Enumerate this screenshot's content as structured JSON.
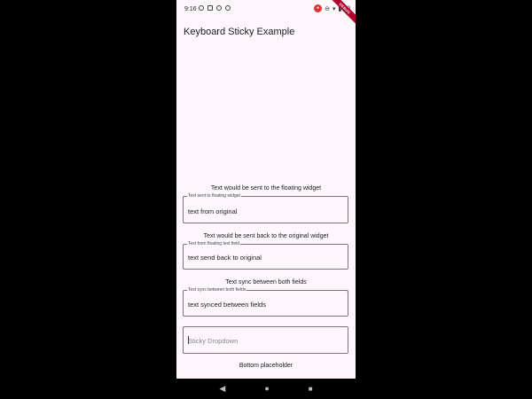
{
  "status_bar": {
    "time": "9:16",
    "notification_icons": [
      "settings-icon",
      "sim-icon",
      "settings-icon",
      "settings-icon"
    ],
    "battery_percent": "99",
    "recording_badge": "●"
  },
  "debug_banner": "DEBUG",
  "app": {
    "title": "Keyboard Sticky Example"
  },
  "fields": [
    {
      "caption": "Text would be sent to the floating widget",
      "label": "Text sent to floating widget",
      "value": "text from original"
    },
    {
      "caption": "Text would be sent back to the original widget",
      "label": "Text from floating text field",
      "value": "text send back to original"
    },
    {
      "caption": "Text sync between both fields",
      "label": "Text sync between both fields",
      "value": "text synced between fields"
    }
  ],
  "dropdown": {
    "placeholder": "Sticky Dropdown"
  },
  "bottom_placeholder": "Bottom placeholder",
  "nav": {
    "back_icon": "◀",
    "home_icon": "●",
    "recents_icon": "■"
  }
}
